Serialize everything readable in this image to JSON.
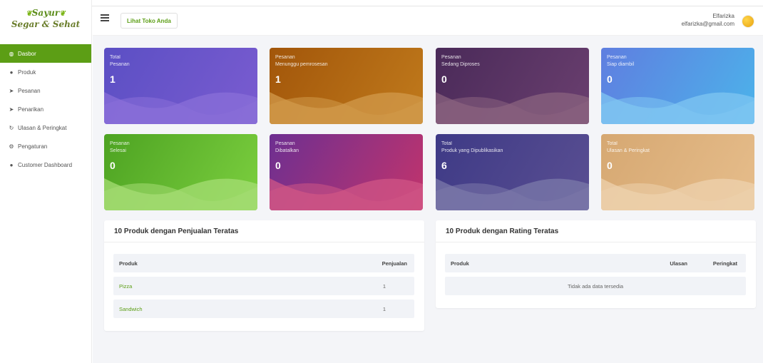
{
  "brand": {
    "line1": "Sayur",
    "line2": "Segar & Sehat"
  },
  "sidebar": {
    "items": [
      {
        "label": "Dasbor",
        "icon": "dashboard-icon",
        "glyph": "◍"
      },
      {
        "label": "Produk",
        "icon": "product-icon",
        "glyph": "●"
      },
      {
        "label": "Pesanan",
        "icon": "send-icon",
        "glyph": "➤"
      },
      {
        "label": "Penarikan",
        "icon": "send-icon",
        "glyph": "➤"
      },
      {
        "label": "Ulasan & Peringkat",
        "icon": "refresh-icon",
        "glyph": "↻"
      },
      {
        "label": "Pengaturan",
        "icon": "gears-icon",
        "glyph": "⚙"
      },
      {
        "label": "Customer Dashboard",
        "icon": "circle-icon",
        "glyph": "●"
      }
    ]
  },
  "topbar": {
    "visit_store": "Lihat Toko Anda",
    "user_name": "Elfarizka",
    "user_email": "elfarizka@gmail.com"
  },
  "cards": [
    {
      "line1": "Total",
      "line2": "Pesanan",
      "value": "1",
      "c1": "#5b4fc4",
      "c2": "#7a5cd0",
      "wave": "#8a6fd8"
    },
    {
      "line1": "Pesanan",
      "line2": "Menunggu pemrosesan",
      "value": "1",
      "c1": "#a2560a",
      "c2": "#c07a1c",
      "wave": "#d29a4b"
    },
    {
      "line1": "Pesanan",
      "line2": "Sedang Diproses",
      "value": "0",
      "c1": "#4a2a59",
      "c2": "#6a3f6f",
      "wave": "#8a637f"
    },
    {
      "line1": "Pesanan",
      "line2": "Siap diambil",
      "value": "0",
      "c1": "#5f7ee0",
      "c2": "#4cb3ea",
      "wave": "#7fc6f2"
    },
    {
      "line1": "Pesanan",
      "line2": "Selesai",
      "value": "0",
      "c1": "#4da322",
      "c2": "#7ccf3f",
      "wave": "#a5dd74"
    },
    {
      "line1": "Pesanan",
      "line2": "Dibatalkan",
      "value": "0",
      "c1": "#6d2f91",
      "c2": "#c2346c",
      "wave": "#d05585"
    },
    {
      "line1": "Total",
      "line2": "Produk yang Dipublikasikan",
      "value": "6",
      "c1": "#3e3a86",
      "c2": "#5a4f92",
      "wave": "#7b79aa"
    },
    {
      "line1": "Total",
      "line2": "Ulasan & Peringkat",
      "value": "0",
      "c1": "#d6a872",
      "c2": "#e6bd8b",
      "wave": "#edd2ad"
    }
  ],
  "top_sales": {
    "title": "10 Produk dengan Penjualan Teratas",
    "col_product": "Produk",
    "col_sales": "Penjualan",
    "rows": [
      {
        "product": "Pizza",
        "sales": "1"
      },
      {
        "product": "Sandwich",
        "sales": "1"
      }
    ]
  },
  "top_rating": {
    "title": "10 Produk dengan Rating Teratas",
    "col_product": "Produk",
    "col_reviews": "Ulasan",
    "col_rating": "Peringkat",
    "empty": "Tidak ada data tersedia"
  }
}
